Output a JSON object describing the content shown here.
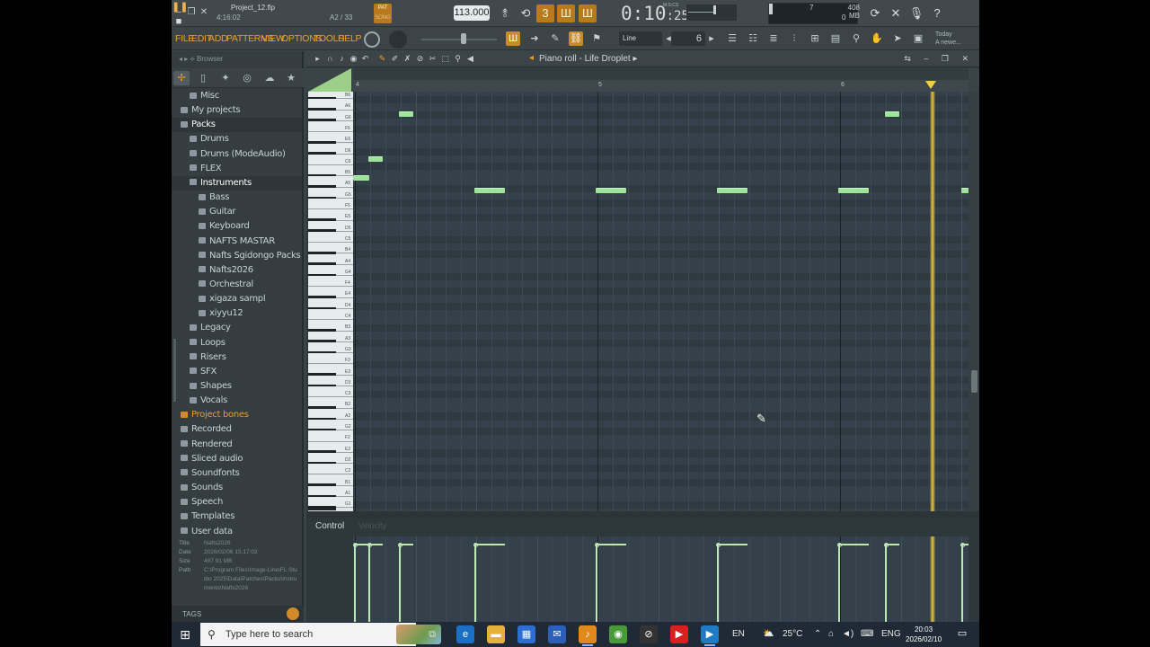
{
  "titlebar": {
    "project_name": "Project_12.flp",
    "project_time": "4:16:02",
    "pattern_info": "A2 / 33",
    "pat_label": "PAT",
    "song_label": "SONG",
    "tempo": "113.000",
    "time_main": "0:10",
    "time_sub": ":25",
    "time_format": "M:S:CS",
    "voices": "7",
    "memory": "408 MB",
    "cpu": "0"
  },
  "menu": {
    "items": [
      "FILE",
      "EDIT",
      "ADD",
      "PATTERNS",
      "VIEW",
      "OPTIONS",
      "TOOLS",
      "HELP"
    ],
    "snap": "Line",
    "step": "6",
    "news": [
      "Today",
      "A newe..."
    ]
  },
  "browser": {
    "title": "Browser",
    "tree": [
      {
        "label": "Misc",
        "level": 1
      },
      {
        "label": "My projects",
        "level": 0
      },
      {
        "label": "Packs",
        "level": 0
      },
      {
        "label": "Drums",
        "level": 1
      },
      {
        "label": "Drums (ModeAudio)",
        "level": 1
      },
      {
        "label": "FLEX",
        "level": 1
      },
      {
        "label": "Instruments",
        "level": 1
      },
      {
        "label": "Bass",
        "level": 2
      },
      {
        "label": "Guitar",
        "level": 2
      },
      {
        "label": "Keyboard",
        "level": 2
      },
      {
        "label": "NAFTS MASTAR",
        "level": 2
      },
      {
        "label": "Nafts Sgidongo Packs",
        "level": 2
      },
      {
        "label": "Nafts2026",
        "level": 2
      },
      {
        "label": "Orchestral",
        "level": 2
      },
      {
        "label": "xigaza sampl",
        "level": 2
      },
      {
        "label": "xiyyu12",
        "level": 2
      },
      {
        "label": "Legacy",
        "level": 1
      },
      {
        "label": "Loops",
        "level": 1
      },
      {
        "label": "Risers",
        "level": 1
      },
      {
        "label": "SFX",
        "level": 1
      },
      {
        "label": "Shapes",
        "level": 1
      },
      {
        "label": "Vocals",
        "level": 1
      },
      {
        "label": "Project bones",
        "level": 0
      },
      {
        "label": "Recorded",
        "level": 0
      },
      {
        "label": "Rendered",
        "level": 0
      },
      {
        "label": "Sliced audio",
        "level": 0
      },
      {
        "label": "Soundfonts",
        "level": 0
      },
      {
        "label": "Sounds",
        "level": 0
      },
      {
        "label": "Speech",
        "level": 0
      },
      {
        "label": "Templates",
        "level": 0
      },
      {
        "label": "User data",
        "level": 0
      }
    ],
    "info": {
      "title_key": "Title",
      "title": "Nafts2026",
      "date_key": "Date",
      "date": "2026/02/06 15:17:02",
      "size_key": "Size",
      "size": "497.91 MB",
      "path_key": "Path",
      "path": "C:\\Program Files\\Image-Line\\FL Studio 2025\\Data\\Patches\\Packs\\Instruments\\Nafts2026"
    },
    "tags_label": "TAGS"
  },
  "pianoroll": {
    "title": "Piano roll - Life Droplet",
    "bar_labels": [
      "4",
      "5",
      "6"
    ],
    "key_labels": [
      "B6",
      "A6",
      "G6",
      "F6",
      "E6",
      "D6",
      "C6",
      "B5",
      "A5",
      "G5",
      "F5",
      "E5",
      "D5",
      "C5",
      "B4",
      "A4",
      "G4",
      "F4",
      "E4",
      "D4",
      "C4",
      "B3",
      "A3",
      "G3",
      "F3",
      "E3",
      "D3",
      "C3",
      "B2",
      "A2",
      "G2",
      "F2",
      "E2",
      "D2",
      "C2",
      "B1",
      "A1",
      "G1"
    ],
    "control_tab": "Control",
    "velocity_tab": "Velocity"
  },
  "taskbar": {
    "search_placeholder": "Type here to search",
    "lang": "EN",
    "temp": "25°C",
    "lang2": "ENG",
    "time": "20:03",
    "date": "2026/02/10",
    "notif_count": "3"
  }
}
